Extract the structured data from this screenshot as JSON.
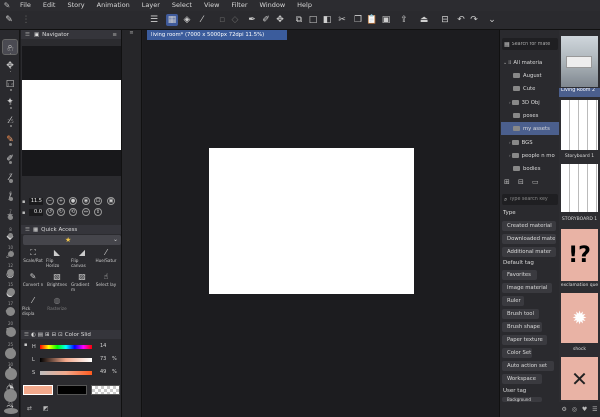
{
  "menu": [
    "File",
    "Edit",
    "Story",
    "Animation",
    "Layer",
    "Select",
    "View",
    "Filter",
    "Window",
    "Help"
  ],
  "document_tab": "living room* (7000 x 5000px 72dpi 11.5%)",
  "navigator": {
    "title": "Navigator",
    "zoom": "11.5",
    "angle": "0.0"
  },
  "quick_access": {
    "title": "Quick Access",
    "items": [
      {
        "label": "Scale/Rot",
        "icon": "scale-icon"
      },
      {
        "label": "Flip Horizo",
        "icon": "flip-horizontal-icon"
      },
      {
        "label": "Flip canvas",
        "icon": "flip-canvas-icon"
      },
      {
        "label": "Hue/Satur",
        "icon": "hue-saturation-icon"
      },
      {
        "label": "Convert n",
        "icon": "convert-icon"
      },
      {
        "label": "Brightnes",
        "icon": "brightness-icon"
      },
      {
        "label": "Gradient m",
        "icon": "gradient-map-icon"
      },
      {
        "label": "Select lay",
        "icon": "select-layer-icon"
      },
      {
        "label": "Pick displa",
        "icon": "eyedropper-icon"
      },
      {
        "label": "Rasterize",
        "icon": "rasterize-icon"
      }
    ]
  },
  "color_slider": {
    "title": "Color Slid",
    "h_label": "H",
    "h_value": "14",
    "l_label": "L",
    "l_value": "73",
    "s_label": "S",
    "s_value": "49",
    "percent": "%",
    "main_color": "#f2a98c",
    "sub_color": "#000000"
  },
  "brush_sizes": [
    "0.7",
    "1",
    "1.5",
    "2",
    "2.5",
    "3",
    "4",
    "5",
    "6",
    "7",
    "8",
    "10",
    "12",
    "15",
    "17",
    "20",
    "25",
    "30",
    "40",
    "50"
  ],
  "materials": {
    "search_placeholder": "Search for mate",
    "tree": [
      "All materia",
      "August",
      "Cute",
      "3D Obj",
      "poses",
      "my assets",
      "BGS",
      "people n mo",
      "bodies"
    ],
    "selected": "my assets",
    "search2_placeholder": "Type search key",
    "type_heading": "Type",
    "types": [
      "Created material",
      "Downloaded mate",
      "Additional mater"
    ],
    "default_tag_heading": "Default tag",
    "tags": [
      "Favorites",
      "Image material",
      "Ruler",
      "Brush tool",
      "Brush shape",
      "Paper texture",
      "Color Set",
      "Auto action set",
      "Workspace"
    ],
    "user_tag_heading": "User tag",
    "user_tags": [
      "Background"
    ]
  },
  "thumbnails": [
    "Living Room 2",
    "Storyboard 1",
    "STORYBOARD 1",
    "exclamation que",
    "shock"
  ]
}
